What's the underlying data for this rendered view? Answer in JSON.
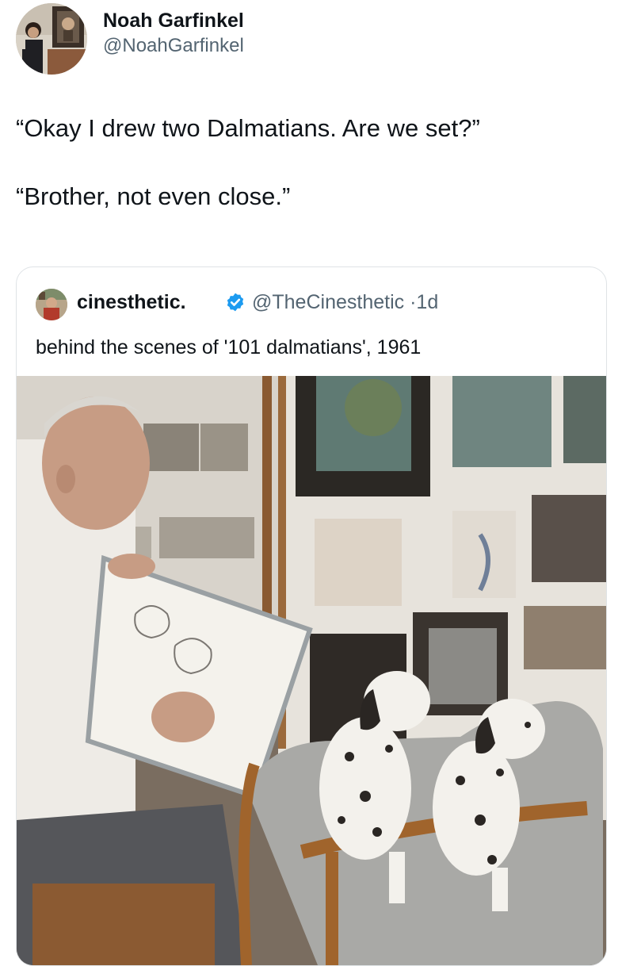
{
  "tweet": {
    "author": {
      "display_name": "Noah Garfinkel",
      "handle": "@NoahGarfinkel",
      "avatar_icon": "profile-photo"
    },
    "text_lines": [
      "“Okay I drew two Dalmatians. Are we set?”",
      "“Brother, not even close.”"
    ]
  },
  "quoted_tweet": {
    "author": {
      "display_name": "cinesthetic.",
      "handle": "@TheCinesthetic",
      "separator": "·",
      "timestamp": "1d",
      "verified": true,
      "verified_icon": "verified-badge-icon",
      "avatar_icon": "profile-photo"
    },
    "text": "behind the scenes of '101 dalmatians', 1961",
    "media": {
      "type": "photo",
      "subject": "animator sketching two Dalmatian puppies sitting on a chair"
    }
  },
  "colors": {
    "text_primary": "#0f1419",
    "text_secondary": "#536471",
    "card_border": "#dfe3e6",
    "verified_blue": "#1d9bf0"
  }
}
